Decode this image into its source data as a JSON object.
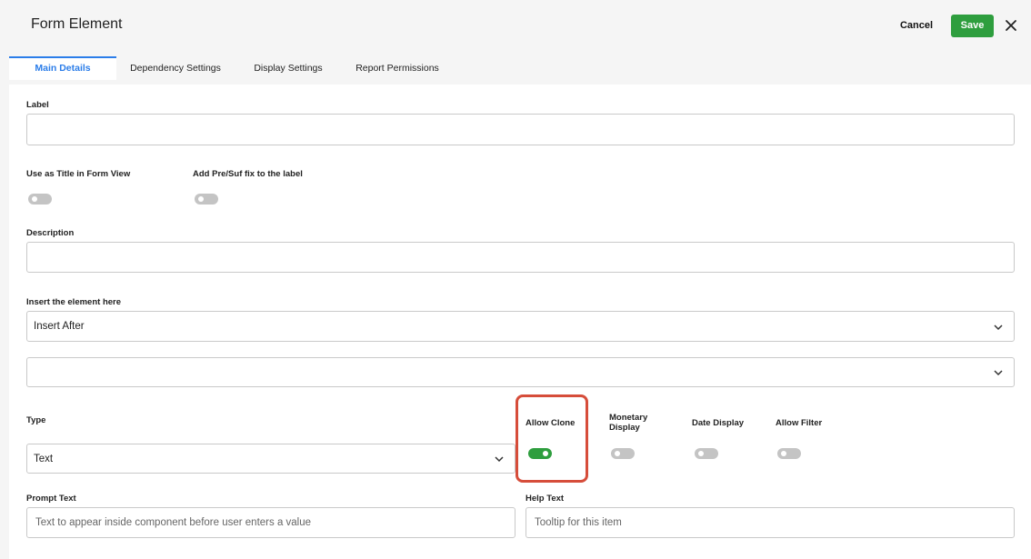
{
  "header": {
    "title": "Form Element",
    "cancel_label": "Cancel",
    "save_label": "Save",
    "close_icon": "close-icon",
    "save_color": "#2e9e3e"
  },
  "tabs": [
    {
      "label": "Main Details",
      "active": true
    },
    {
      "label": "Dependency Settings",
      "active": false
    },
    {
      "label": "Display Settings",
      "active": false
    },
    {
      "label": "Report Permissions",
      "active": false
    }
  ],
  "accent_color": "#2b7de9",
  "highlight_color": "#d64d3a",
  "form": {
    "label_field": {
      "label": "Label",
      "value": ""
    },
    "use_as_title": {
      "label": "Use as Title in Form View",
      "on": false
    },
    "add_prefix": {
      "label": "Add Pre/Suf fix to the label",
      "on": false
    },
    "description": {
      "label": "Description",
      "value": ""
    },
    "insert_element": {
      "label": "Insert the element here",
      "value": "Insert After"
    },
    "insert_target": {
      "value": ""
    },
    "type": {
      "label": "Type",
      "value": "Text"
    },
    "allow_clone": {
      "label": "Allow Clone",
      "on": true
    },
    "monetary_display": {
      "label_line1": "Monetary",
      "label_line2": "Display",
      "on": false
    },
    "date_display": {
      "label": "Date Display",
      "on": false
    },
    "allow_filter": {
      "label": "Allow Filter",
      "on": false
    },
    "prompt_text": {
      "label": "Prompt Text",
      "placeholder": "Text to appear inside component before user enters a value"
    },
    "help_text": {
      "label": "Help Text",
      "placeholder": "Tooltip for this item"
    }
  }
}
